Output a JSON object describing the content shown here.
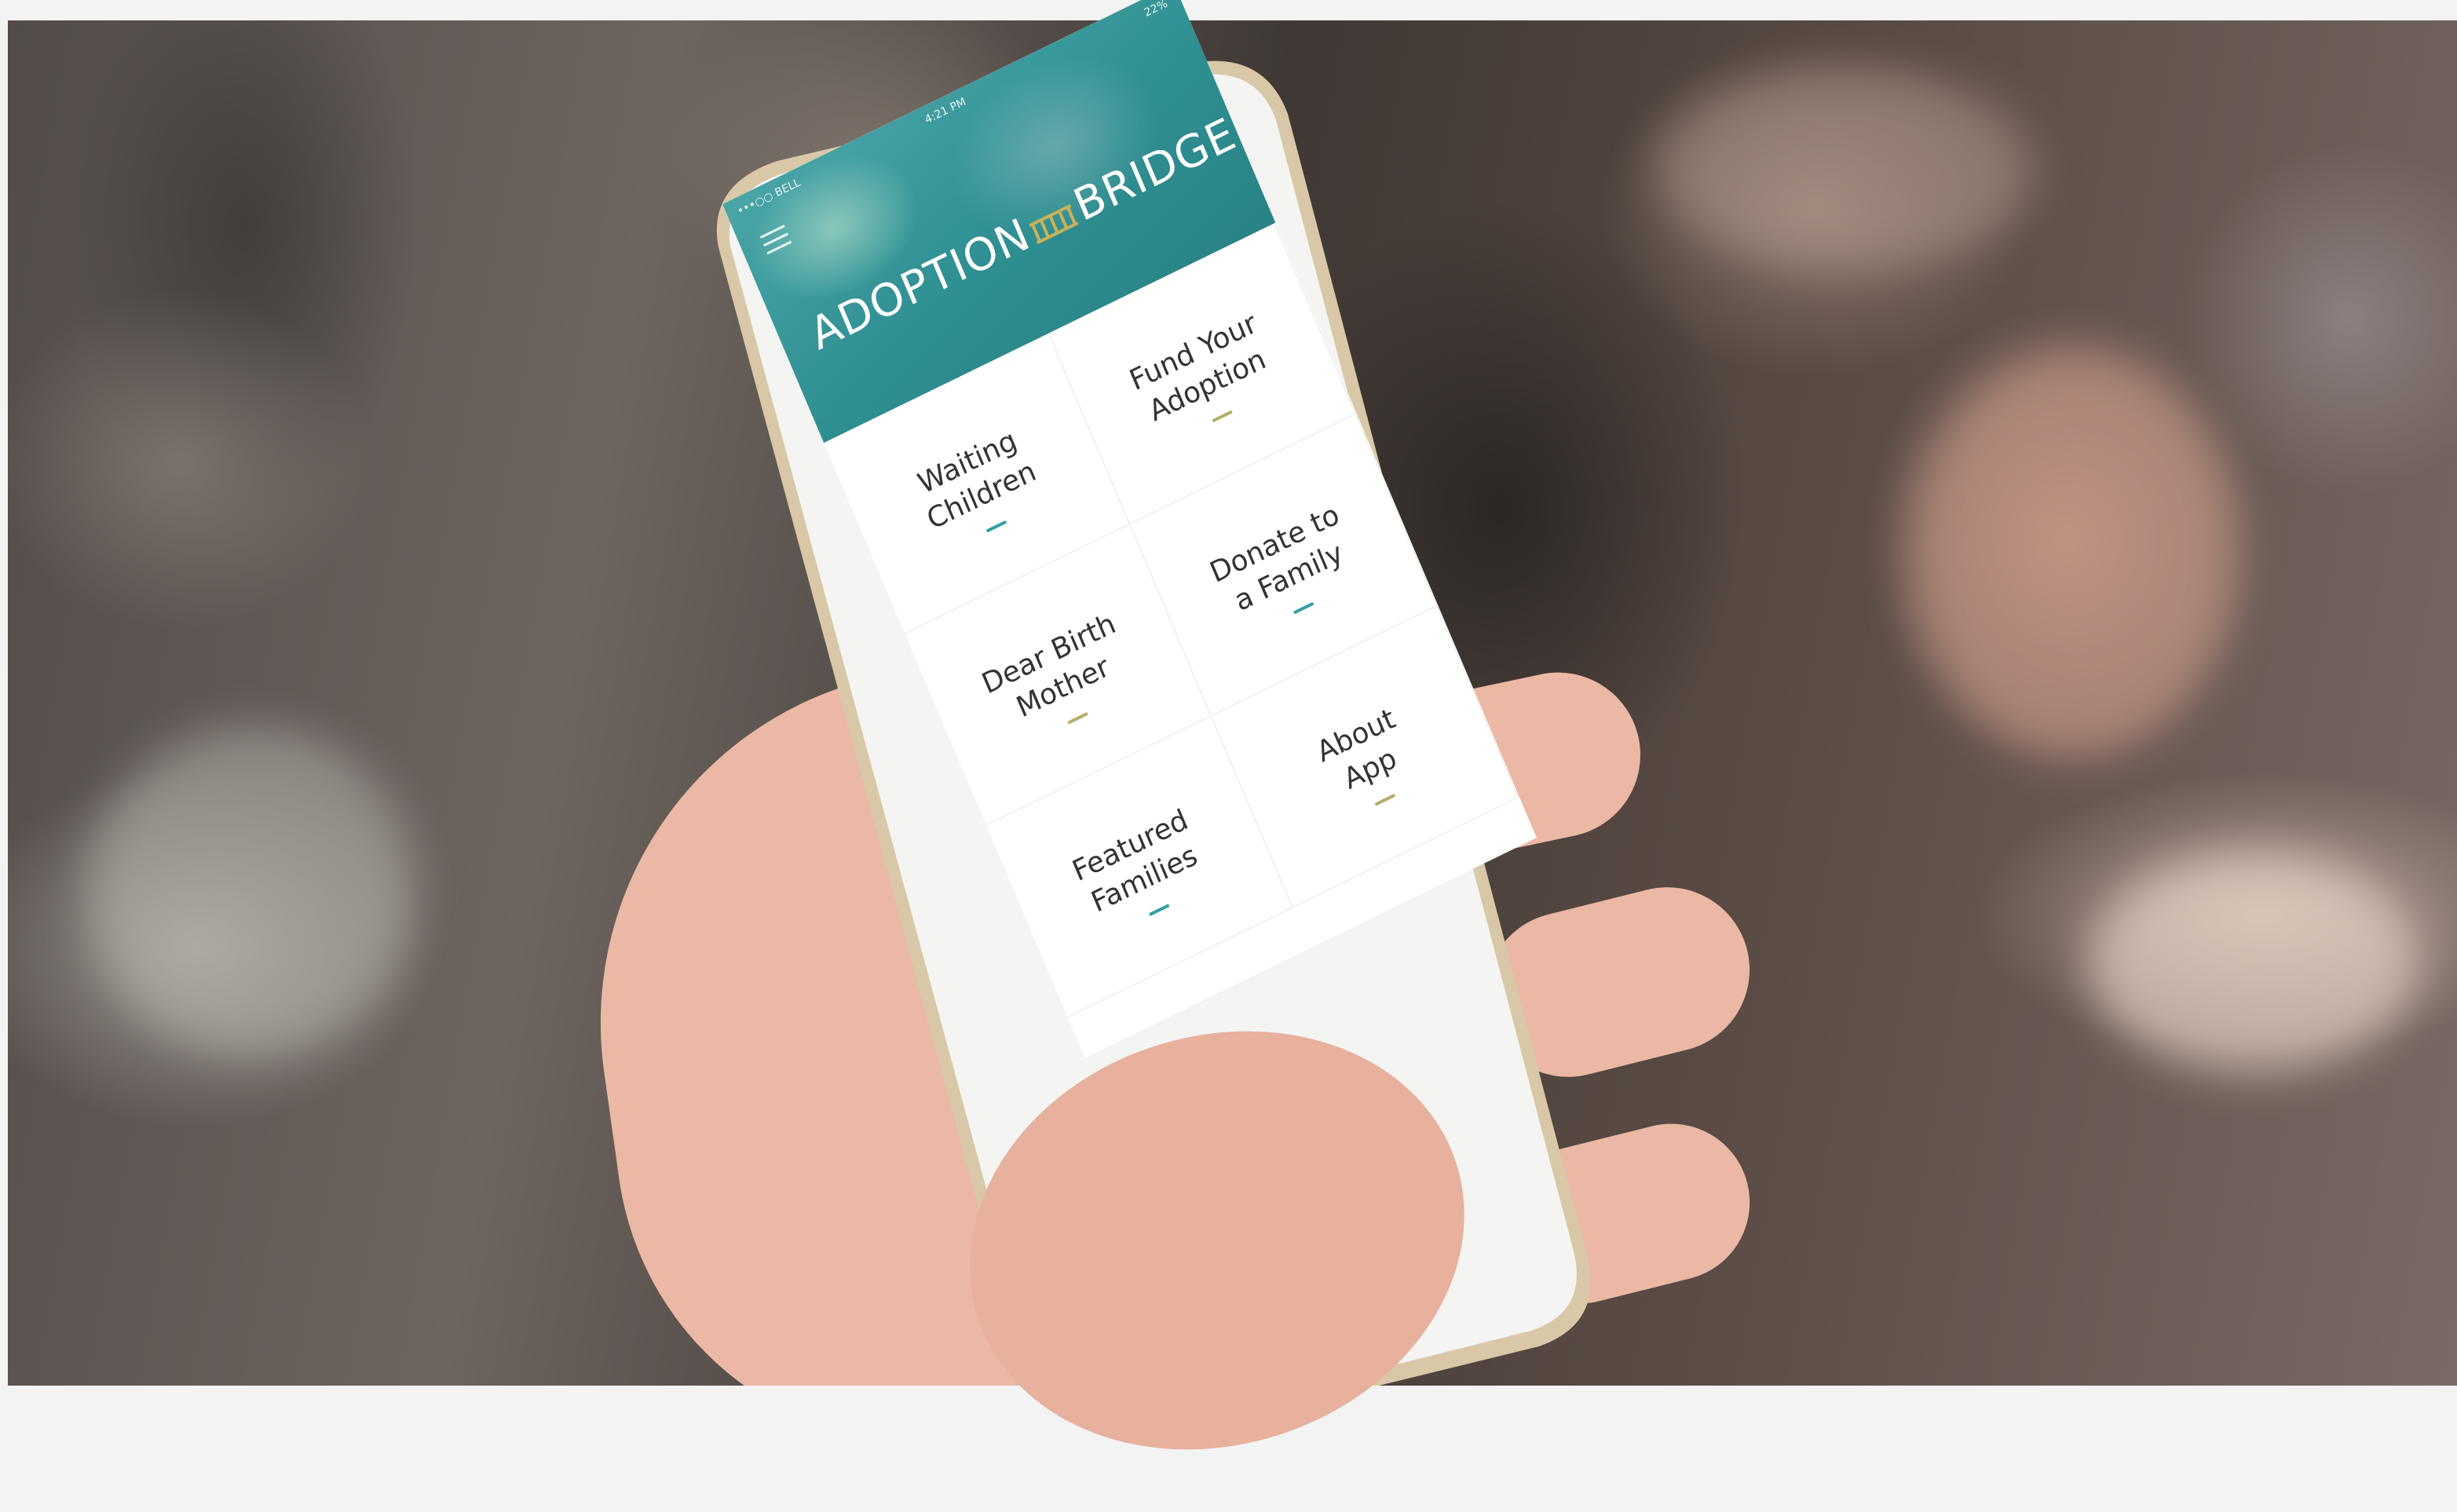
{
  "scene": {
    "description_type": "photo",
    "colors": {
      "accent_teal": "#2fa0a6",
      "accent_olive": "#b3ae6a",
      "header": "#3a9a9c"
    }
  },
  "app": {
    "status_bar": {
      "carrier": "•••○○ BELL",
      "time": "4:21 PM",
      "battery": "22%"
    },
    "logo": {
      "left": "ADOPTION",
      "right": "BRIDGE"
    },
    "menu_icon": "hamburger-icon",
    "tiles": [
      {
        "label": "Waiting\nChildren",
        "accent": "#2fa0a6"
      },
      {
        "label": "Fund Your\nAdoption",
        "accent": "#b3ae6a"
      },
      {
        "label": "Dear Birth\nMother",
        "accent": "#b3ae6a"
      },
      {
        "label": "Donate to\na Family",
        "accent": "#2fa0a6"
      },
      {
        "label": "Featured\nFamilies",
        "accent": "#2fa0a6"
      },
      {
        "label": "About\nApp",
        "accent": "#b3ae6a"
      }
    ]
  }
}
